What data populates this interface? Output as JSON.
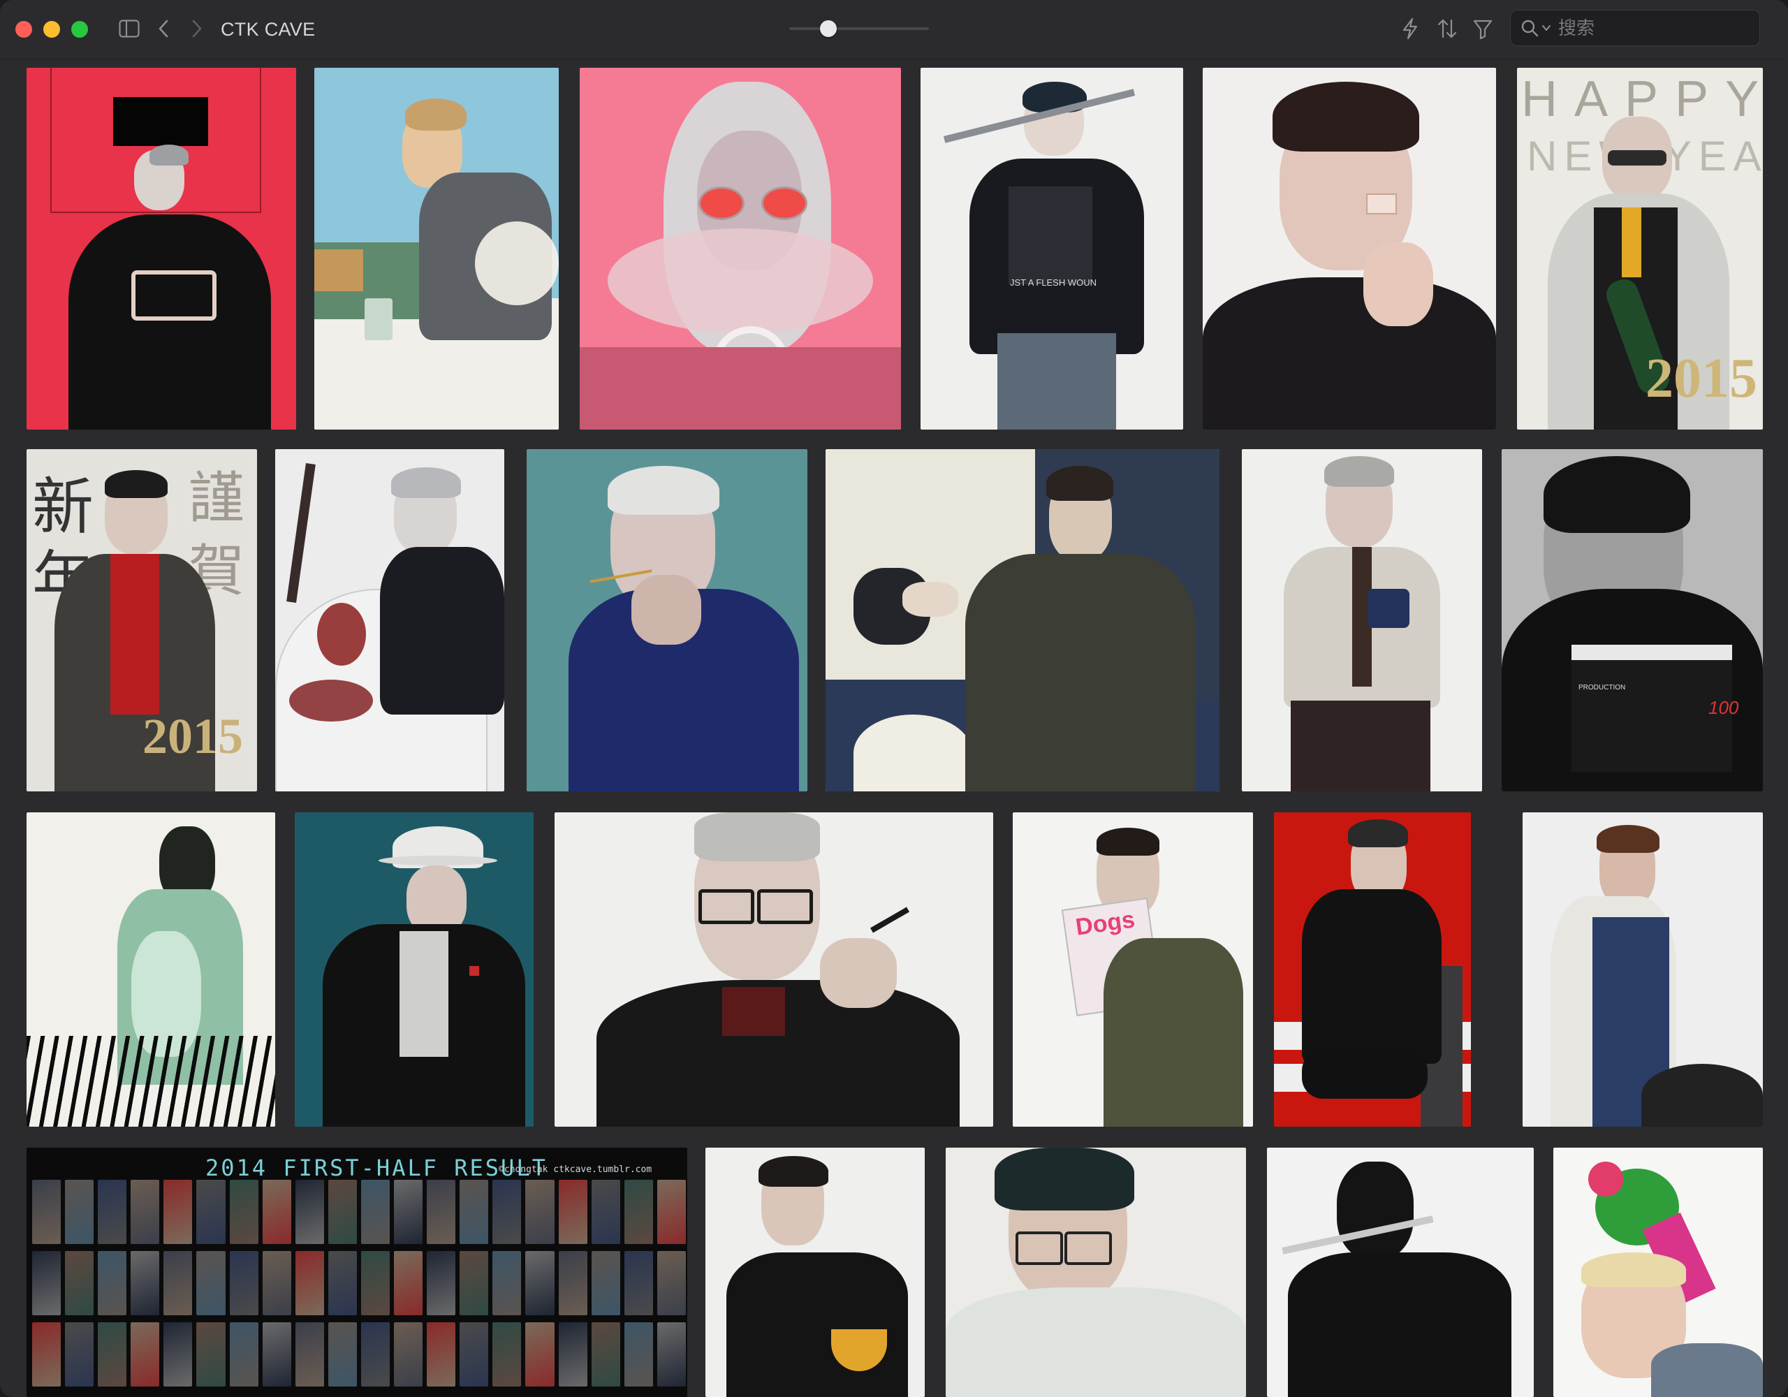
{
  "window": {
    "title": "CTK CAVE",
    "zoom_level": 0.25
  },
  "toolbar": {
    "icons": [
      "sidebar-toggle-icon",
      "chevron-left-icon",
      "chevron-right-icon",
      "bolt-icon",
      "sort-icon",
      "filter-icon"
    ],
    "search": {
      "placeholder": "搜索",
      "value": ""
    }
  },
  "colors": {
    "close": "#ff5f57",
    "minimize": "#febc2e",
    "maximize": "#28c840",
    "chrome_bg": "#2b2b2e",
    "cyan_title": "#7ad0d8"
  },
  "gallery": {
    "collage": {
      "title": "2014 FIRST-HALF RESULT",
      "credit": "©chongtak ctkcave.tumblr.com"
    },
    "tile_texts": {
      "flesh_wound_shirt": "JST A FLESH WOUN",
      "happy_new_year_1": "HAPPY",
      "happy_new_year_2": "NEW YEAR",
      "year_2015_a": "2015",
      "year_2015_b": "2015",
      "kanji_1": "新",
      "kanji_2": "年",
      "kanji_3": "謹",
      "kanji_4": "賀",
      "magazine": "Dogs",
      "clapper_take": "100",
      "clapper_label": "PRODUCTION"
    }
  }
}
